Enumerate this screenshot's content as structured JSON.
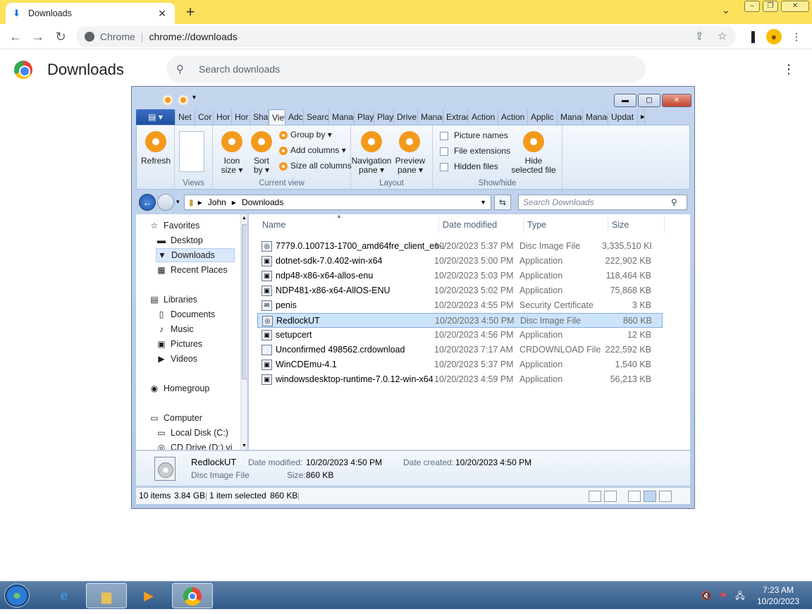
{
  "browser": {
    "tab_title": "Downloads",
    "omnibox_site": "Chrome",
    "omnibox_url": "chrome://downloads"
  },
  "page": {
    "title": "Downloads",
    "search_placeholder": "Search downloads"
  },
  "explorer": {
    "ribbon_tabs": [
      "Net",
      "Cor",
      "Hor",
      "Hor",
      "Sha",
      "Viev",
      "Adc",
      "Search",
      "Manag",
      "Play",
      "Play",
      "Drive",
      "Manag",
      "Extract",
      "Action",
      "Action",
      "Applic",
      "Manag",
      "Manag",
      "Updat"
    ],
    "active_tab_index": 5,
    "ribbon": {
      "refresh": "Refresh",
      "views_group": "Views",
      "icon_size": "Icon\nsize ▾",
      "sort_by": "Sort\nby ▾",
      "group_by": "Group by ▾",
      "add_columns": "Add columns ▾",
      "size_all_columns": "Size all columns",
      "current_view_group": "Current view",
      "navigation_pane": "Navigation\npane ▾",
      "preview_pane": "Preview\npane ▾",
      "layout_group": "Layout",
      "picture_names": "Picture names",
      "file_extensions": "File extensions",
      "hidden_files": "Hidden files",
      "hide_selected": "Hide\nselected file",
      "show_hide_group": "Show/hide"
    },
    "address": {
      "crumb1": "John",
      "crumb2": "Downloads",
      "search_placeholder": "Search Downloads"
    },
    "nav": [
      {
        "label": "Favorites",
        "icon": "star-icon",
        "indent": 0
      },
      {
        "label": "Desktop",
        "icon": "desktop-icon",
        "indent": 1
      },
      {
        "label": "Downloads",
        "icon": "downloads-folder-icon",
        "indent": 1
      },
      {
        "label": "Recent Places",
        "icon": "recent-places-icon",
        "indent": 1
      },
      {
        "label": "Libraries",
        "icon": "libraries-icon",
        "indent": 0
      },
      {
        "label": "Documents",
        "icon": "documents-icon",
        "indent": 1
      },
      {
        "label": "Music",
        "icon": "music-icon",
        "indent": 1
      },
      {
        "label": "Pictures",
        "icon": "pictures-icon",
        "indent": 1
      },
      {
        "label": "Videos",
        "icon": "videos-icon",
        "indent": 1
      },
      {
        "label": "Homegroup",
        "icon": "homegroup-icon",
        "indent": 0
      },
      {
        "label": "Computer",
        "icon": "computer-icon",
        "indent": 0
      },
      {
        "label": "Local Disk (C:)",
        "icon": "disk-icon",
        "indent": 1
      },
      {
        "label": "CD Drive (D:) vi",
        "icon": "cd-drive-icon",
        "indent": 1
      }
    ],
    "columns": [
      "Name",
      "Date modified",
      "Type",
      "Size"
    ],
    "files": [
      {
        "name": "7779.0.100713-1700_amd64fre_client_en-...",
        "date": "10/20/2023 5:37 PM",
        "type": "Disc Image File",
        "size": "3,335,510 KB"
      },
      {
        "name": "dotnet-sdk-7.0.402-win-x64",
        "date": "10/20/2023 5:00 PM",
        "type": "Application",
        "size": "222,902 KB"
      },
      {
        "name": "ndp48-x86-x64-allos-enu",
        "date": "10/20/2023 5:03 PM",
        "type": "Application",
        "size": "118,464 KB"
      },
      {
        "name": "NDP481-x86-x64-AllOS-ENU",
        "date": "10/20/2023 5:02 PM",
        "type": "Application",
        "size": "75,868 KB"
      },
      {
        "name": "penis",
        "date": "10/20/2023 4:55 PM",
        "type": "Security Certificate",
        "size": "3 KB"
      },
      {
        "name": "RedlockUT",
        "date": "10/20/2023 4:50 PM",
        "type": "Disc Image File",
        "size": "860 KB"
      },
      {
        "name": "setupcert",
        "date": "10/20/2023 4:56 PM",
        "type": "Application",
        "size": "12 KB"
      },
      {
        "name": "Unconfirmed 498562.crdownload",
        "date": "10/20/2023 7:17 AM",
        "type": "CRDOWNLOAD File",
        "size": "222,592 KB"
      },
      {
        "name": "WinCDEmu-4.1",
        "date": "10/20/2023 5:37 PM",
        "type": "Application",
        "size": "1,540 KB"
      },
      {
        "name": "windowsdesktop-runtime-7.0.12-win-x64",
        "date": "10/20/2023 4:59 PM",
        "type": "Application",
        "size": "56,213 KB"
      }
    ],
    "selected_index": 5,
    "details": {
      "name": "RedlockUT",
      "type": "Disc Image File",
      "date_modified_label": "Date modified:",
      "date_modified": "10/20/2023 4:50 PM",
      "size_label": "Size:",
      "size": "860 KB",
      "date_created_label": "Date created:",
      "date_created": "10/20/2023 4:50 PM"
    },
    "status": {
      "items": "10 items",
      "total": "3.84 GB",
      "selected": "1 item selected",
      "selected_size": "860 KB"
    }
  },
  "taskbar": {
    "time": "7:23 AM",
    "date": "10/20/2023"
  },
  "colors": {
    "tabstrip": "#fce15c",
    "accent": "#f39a1d",
    "selection": "#cce4fb"
  }
}
